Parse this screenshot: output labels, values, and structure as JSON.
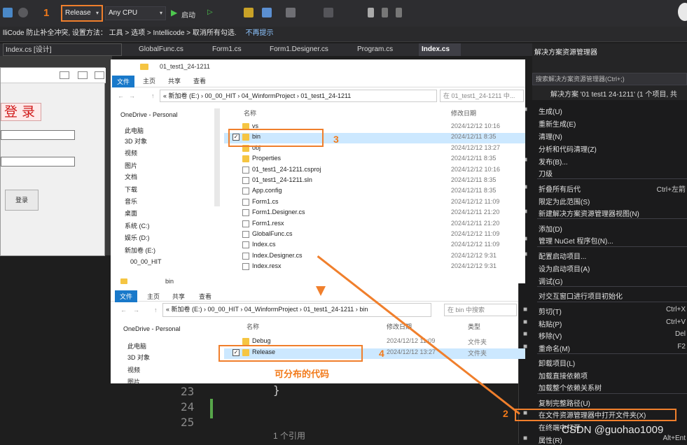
{
  "toolbar": {
    "config_value": "Release",
    "platform_value": "Any CPU",
    "start_label": "启动",
    "step1": "1"
  },
  "infobar": {
    "message": "lliCode 防止补全冲突, 设置方法： 工具 > 选项 > Intellicode > 取消所有勾选.",
    "link": "不再提示"
  },
  "editor_tabs": {
    "left_tab": "Index.cs [设计]",
    "tabs": [
      "GlobalFunc.cs",
      "Form1.cs",
      "Form1.Designer.cs",
      "Program.cs",
      "Index.cs"
    ]
  },
  "winform": {
    "title_text": "登 录",
    "login_button": "登录"
  },
  "code": {
    "line_numbers": [
      "23",
      "24",
      "25"
    ],
    "brace": "}",
    "references": "1 个引用"
  },
  "solution_explorer": {
    "title": "解决方案资源管理器",
    "search_placeholder": "搜索解决方案资源管理器(Ctrl+;)",
    "solution_item": "解决方案 '01 test1 24-1211' (1 个项目, 共"
  },
  "context_menu": {
    "items": [
      {
        "label": "生成(U)",
        "shortcut": "",
        "icon": "build-icon"
      },
      {
        "label": "重新生成(E)",
        "shortcut": ""
      },
      {
        "label": "清理(N)",
        "shortcut": ""
      },
      {
        "label": "分析和代码清理(Z)",
        "shortcut": ""
      },
      {
        "label": "发布(B)...",
        "shortcut": "",
        "icon": "globe-icon"
      },
      {
        "label": "刀级",
        "shortcut": ""
      },
      {
        "label": "折叠所有后代",
        "shortcut": "Ctrl+左箭",
        "icon": "collapse-icon"
      },
      {
        "label": "限定为此范围(S)",
        "shortcut": ""
      },
      {
        "label": "新建解决方案资源管理器视图(N)",
        "shortcut": "",
        "icon": "view-icon"
      },
      {
        "label": "添加(D)",
        "shortcut": ""
      },
      {
        "label": "管理 NuGet 程序包(N)...",
        "shortcut": "",
        "icon": "nuget-icon"
      },
      {
        "label": "配置启动项目...",
        "shortcut": "",
        "icon": "gear-icon"
      },
      {
        "label": "设为启动项目(A)",
        "shortcut": ""
      },
      {
        "label": "调试(G)",
        "shortcut": ""
      },
      {
        "label": "对交互窗口进行项目初始化",
        "shortcut": ""
      },
      {
        "label": "剪切(T)",
        "shortcut": "Ctrl+X",
        "icon": "cut-icon"
      },
      {
        "label": "粘贴(P)",
        "shortcut": "Ctrl+V",
        "icon": "paste-icon"
      },
      {
        "label": "移除(V)",
        "shortcut": "Del",
        "icon": "remove-icon"
      },
      {
        "label": "重命名(M)",
        "shortcut": "F2",
        "icon": "rename-icon"
      },
      {
        "label": "卸载项目(L)",
        "shortcut": ""
      },
      {
        "label": "加载直接依赖项",
        "shortcut": ""
      },
      {
        "label": "加载整个依赖关系树",
        "shortcut": ""
      },
      {
        "label": "复制完整路径(U)",
        "shortcut": ""
      },
      {
        "label": "在文件资源管理器中打开文件夹(X)",
        "shortcut": "",
        "icon": "open-folder-icon"
      },
      {
        "label": "在终端中打开",
        "shortcut": ""
      },
      {
        "label": "属性(R)",
        "shortcut": "Alt+Ent",
        "icon": "wrench-icon"
      }
    ]
  },
  "explorer1": {
    "title": "01_test1_24-1211",
    "ribbon_tabs": [
      "文件",
      "主页",
      "共享",
      "查看"
    ],
    "address": [
      "新加卷 (E:)",
      "00_00_HIT",
      "04_WinformProject",
      "01_test1_24-1211"
    ],
    "search": "在 01_test1_24-1211 中...",
    "col_name": "名称",
    "col_date": "修改日期",
    "nav": [
      "OneDrive - Personal",
      "此电脑",
      "3D 对象",
      "视频",
      "图片",
      "文档",
      "下载",
      "音乐",
      "桌面",
      "系统 (C:)",
      "娱乐 (D:)",
      "新加卷 (E:)",
      "00_00_HIT"
    ],
    "files": [
      {
        "name": "vs",
        "date": "2024/12/12 10:16",
        "type": "folder"
      },
      {
        "name": "bin",
        "date": "2024/12/11 8:35",
        "type": "folder"
      },
      {
        "name": "obj",
        "date": "2024/12/12 13:27",
        "type": "folder"
      },
      {
        "name": "Properties",
        "date": "2024/12/11 8:35",
        "type": "folder"
      },
      {
        "name": "01_test1_24-1211.csproj",
        "date": "2024/12/12 10:16",
        "type": "file"
      },
      {
        "name": "01_test1_24-1211.sln",
        "date": "2024/12/11 8:35",
        "type": "file"
      },
      {
        "name": "App.config",
        "date": "2024/12/11 8:35",
        "type": "file"
      },
      {
        "name": "Form1.cs",
        "date": "2024/12/12 11:09",
        "type": "file"
      },
      {
        "name": "Form1.Designer.cs",
        "date": "2024/12/11 21:20",
        "type": "file"
      },
      {
        "name": "Form1.resx",
        "date": "2024/12/11 21:20",
        "type": "file"
      },
      {
        "name": "GlobalFunc.cs",
        "date": "2024/12/12 11:09",
        "type": "file"
      },
      {
        "name": "Index.cs",
        "date": "2024/12/12 11:09",
        "type": "file"
      },
      {
        "name": "Index.Designer.cs",
        "date": "2024/12/12 9:31",
        "type": "file"
      },
      {
        "name": "Index.resx",
        "date": "2024/12/12 9:31",
        "type": "file"
      }
    ]
  },
  "explorer2": {
    "title": "bin",
    "ribbon_tabs": [
      "文件",
      "主页",
      "共享",
      "查看"
    ],
    "address": [
      "新加卷 (E:)",
      "00_00_HIT",
      "04_WinformProject",
      "01_test1_24-1211",
      "bin"
    ],
    "search": "在 bin 中搜索",
    "col_name": "名称",
    "col_date": "修改日期",
    "col_type": "类型",
    "nav": [
      "OneDrive - Personal",
      "此电脑",
      "3D 对象",
      "视频",
      "图片"
    ],
    "files": [
      {
        "name": "Debug",
        "date": "2024/12/12 11:09",
        "type": "文件夹"
      },
      {
        "name": "Release",
        "date": "2024/12/12 13:27",
        "type": "文件夹"
      }
    ]
  },
  "annotations": {
    "step2": "2",
    "step3": "3",
    "step4": "4",
    "caption": "可分布的代码"
  },
  "watermark": "CSDN @guohao1009"
}
